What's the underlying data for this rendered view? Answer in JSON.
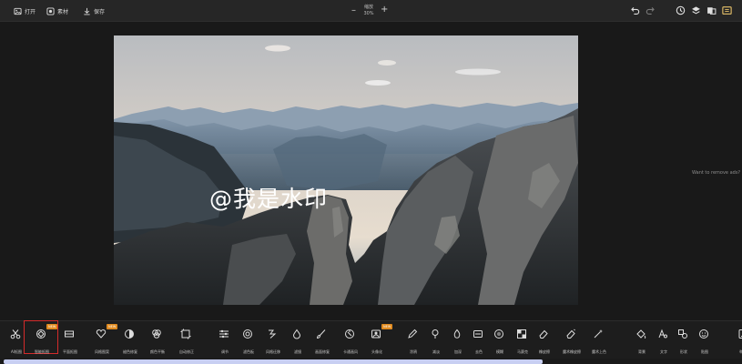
{
  "topbar": {
    "open_label": "打开",
    "material_label": "素材",
    "save_label": "保存",
    "zoom_label": "缩放",
    "zoom_value": "30%"
  },
  "canvas": {
    "watermark_text": "@我是水印"
  },
  "ad_text": "Want to remove ads?",
  "tools": [
    {
      "label": "AI抠图",
      "icon": "scissors-icon"
    },
    {
      "label": "智能抠图",
      "icon": "smart-cutout-icon",
      "badge": "NEW"
    },
    {
      "label": "平面抠图",
      "icon": "plane-cutout-icon"
    },
    {
      "label": "风格图案",
      "icon": "style-pattern-icon",
      "badge": "NEW"
    },
    {
      "label": "褪色修复",
      "icon": "fade-repair-icon"
    },
    {
      "label": "颜色平衡",
      "icon": "color-balance-icon"
    },
    {
      "label": "自动修正",
      "icon": "auto-correct-icon"
    },
    {
      "label": "调节",
      "icon": "sliders-icon"
    },
    {
      "label": "滤色板",
      "icon": "filter-icon"
    },
    {
      "label": "风格迁移",
      "icon": "style-transfer-icon"
    },
    {
      "label": "滤镜",
      "icon": "drop-icon"
    },
    {
      "label": "画面修复",
      "icon": "brush-icon"
    },
    {
      "label": "卡通画风",
      "icon": "cartoon-icon"
    },
    {
      "label": "头像化",
      "icon": "avatar-icon",
      "badge": "NEW"
    },
    {
      "label": "涂鸦",
      "icon": "pencil-icon"
    },
    {
      "label": "减淡",
      "icon": "dodge-icon"
    },
    {
      "label": "加深",
      "icon": "burn-icon"
    },
    {
      "label": "去色",
      "icon": "desaturate-icon"
    },
    {
      "label": "模糊",
      "icon": "blur-icon"
    },
    {
      "label": "马赛克",
      "icon": "mosaic-icon"
    },
    {
      "label": "橡皮擦",
      "icon": "eraser-icon"
    },
    {
      "label": "魔术橡皮擦",
      "icon": "magic-eraser-icon"
    },
    {
      "label": "魔术上色",
      "icon": "magic-wand-icon"
    },
    {
      "label": "背景",
      "icon": "paint-bucket-icon"
    },
    {
      "label": "文字",
      "icon": "text-icon"
    },
    {
      "label": "形状",
      "icon": "shapes-icon"
    },
    {
      "label": "贴图",
      "icon": "sticker-icon"
    },
    {
      "label": "举报",
      "icon": "report-icon"
    }
  ],
  "colors": {
    "accent": "#e08a1f",
    "highlight": "#d42b2b",
    "scrollbar": "#c8cff2"
  }
}
